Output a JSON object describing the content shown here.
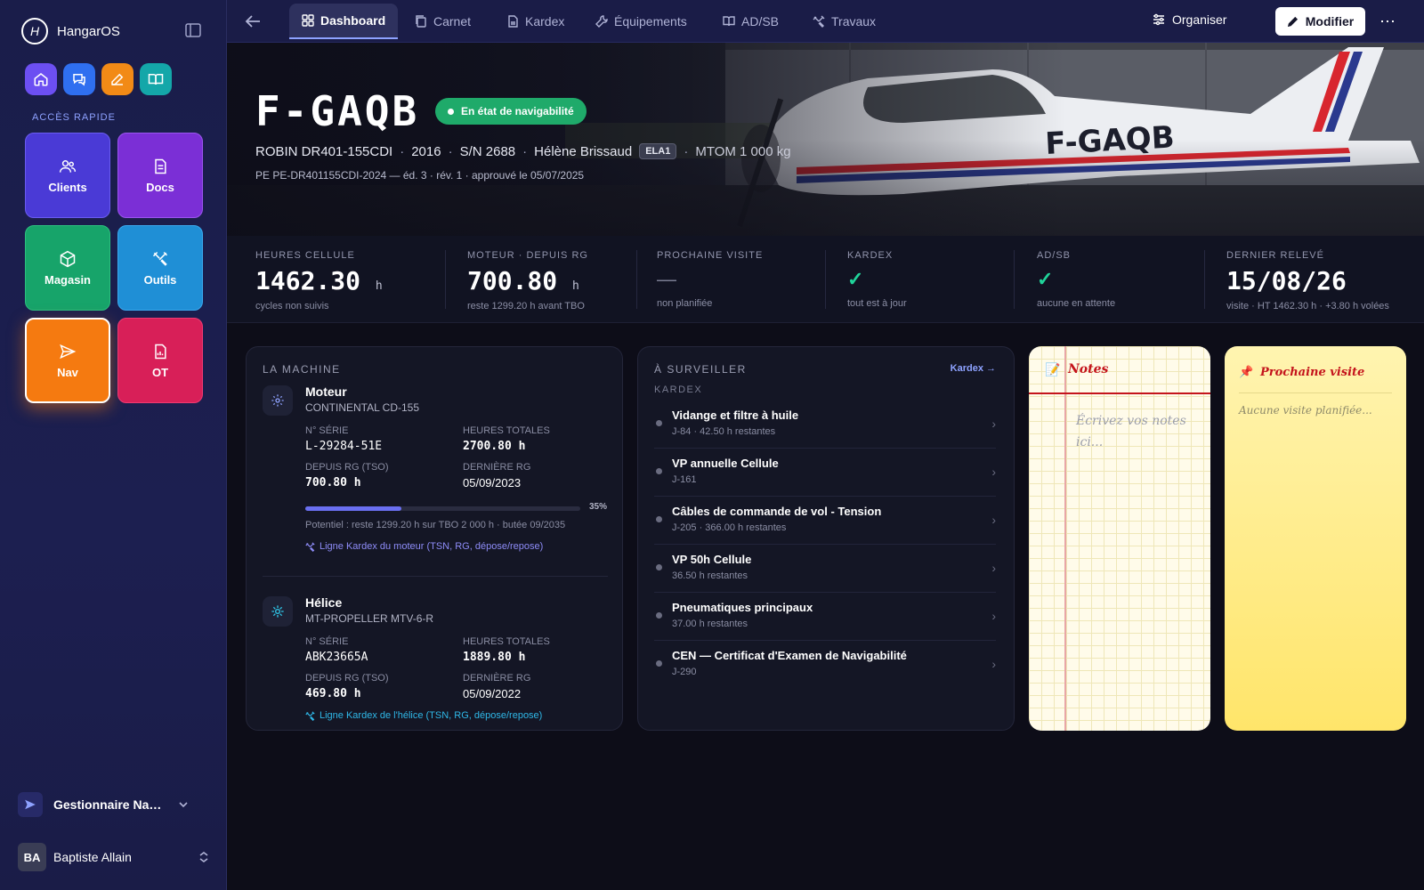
{
  "app": {
    "name": "HangarOS"
  },
  "sidebar": {
    "section_label": "ACCÈS RAPIDE",
    "quick_icons": [
      {
        "name": "home-icon",
        "color": "#6c4ff2"
      },
      {
        "name": "chat-icon",
        "color": "#2f6ff0"
      },
      {
        "name": "edit-icon",
        "color": "#f28a16"
      },
      {
        "name": "book-icon",
        "color": "#14a7a9"
      }
    ],
    "tiles": [
      {
        "label": "Clients",
        "icon": "users-icon",
        "color": "#4a3ad6"
      },
      {
        "label": "Docs",
        "icon": "document-icon",
        "color": "#7b2fd6"
      },
      {
        "label": "Magasin",
        "icon": "box-icon",
        "color": "#17a46a"
      },
      {
        "label": "Outils",
        "icon": "tools-icon",
        "color": "#1f8fd6"
      },
      {
        "label": "Nav",
        "icon": "send-icon",
        "color": "#f57a10"
      },
      {
        "label": "OT",
        "icon": "file-chart-icon",
        "color": "#d81f58"
      }
    ],
    "role": "Gestionnaire Navigabilité",
    "user": {
      "initials": "BA",
      "name": "Baptiste Allain"
    }
  },
  "topbar": {
    "tabs": [
      {
        "label": "Dashboard",
        "active": true
      },
      {
        "label": "Carnet"
      },
      {
        "label": "Kardex"
      },
      {
        "label": "Équipements"
      },
      {
        "label": "AD/SB"
      },
      {
        "label": "Travaux"
      }
    ],
    "organize_label": "Organiser",
    "modify_label": "Modifier"
  },
  "aircraft": {
    "registration": "F-GAQB",
    "status": "En état de navigabilité",
    "model": "ROBIN DR401-155CDI",
    "year": "2016",
    "serial": "S/N  2688",
    "owner": "Hélène Brissaud",
    "category": "ELA1",
    "mtom": "MTOM 1 000 kg",
    "program": "PE PE-DR401155CDI-2024 — éd. 3 · rév. 1 · approuvé le 05/07/2025"
  },
  "stats": [
    {
      "label": "HEURES CELLULE",
      "value": "1462.30",
      "unit": "h",
      "sub": "cycles non suivis"
    },
    {
      "label": "MOTEUR · DEPUIS RG",
      "value": "700.80",
      "unit": "h",
      "sub": "reste 1299.20 h avant TBO"
    },
    {
      "label": "PROCHAINE VISITE",
      "value": "—",
      "sub": "non planifiée"
    },
    {
      "label": "KARDEX",
      "value": "✓",
      "sub": "tout est à jour"
    },
    {
      "label": "AD/SB",
      "value": "✓",
      "sub": "aucune en attente"
    },
    {
      "label": "DERNIER RELEVÉ",
      "value": "15/08/26",
      "sub": "visite · HT 1462.30 h · +3.80 h volées"
    }
  ],
  "machine": {
    "title": "LA MACHINE",
    "engine": {
      "name": "Moteur",
      "model": "CONTINENTAL CD-155",
      "serial_label": "N° SÉRIE",
      "serial": "L-29284-51E",
      "hours_label": "HEURES TOTALES",
      "hours": "2700.80 h",
      "tso_label": "DEPUIS RG (TSO)",
      "tso": "700.80 h",
      "last_rg_label": "DERNIÈRE RG",
      "last_rg": "05/09/2023",
      "progress": 0.35,
      "progress_label": "35%",
      "potential": "Potentiel : reste 1299.20 h sur TBO 2 000 h · butée 09/2035",
      "link": "Ligne Kardex du moteur (TSN, RG, dépose/repose)"
    },
    "propeller": {
      "name": "Hélice",
      "model": "MT-PROPELLER MTV-6-R",
      "serial_label": "N° SÉRIE",
      "serial": "ABK23665A",
      "hours_label": "HEURES TOTALES",
      "hours": "1889.80 h",
      "tso_label": "DEPUIS RG (TSO)",
      "tso": "469.80 h",
      "last_rg_label": "DERNIÈRE RG",
      "last_rg": "05/09/2022",
      "link": "Ligne Kardex de l'hélice (TSN, RG, dépose/repose)"
    }
  },
  "watch": {
    "title": "À SURVEILLER",
    "link": "Kardex →",
    "section": "KARDEX",
    "items": [
      {
        "title": "Vidange et filtre à huile",
        "sub": "J-84 · 42.50 h restantes"
      },
      {
        "title": "VP annuelle Cellule",
        "sub": "J-161"
      },
      {
        "title": "Câbles de commande de vol - Tension",
        "sub": "J-205 · 366.00 h restantes"
      },
      {
        "title": "VP 50h Cellule",
        "sub": "36.50 h restantes"
      },
      {
        "title": "Pneumatiques principaux",
        "sub": "37.00 h restantes"
      },
      {
        "title": "CEN — Certificat d'Examen de Navigabilité",
        "sub": "J-290"
      }
    ]
  },
  "notes": {
    "emoji": "📝",
    "title": "Notes",
    "placeholder": "Écrivez vos notes ici..."
  },
  "next_visit": {
    "emoji": "📌",
    "title": "Prochaine visite",
    "placeholder": "Aucune visite planifiée..."
  }
}
